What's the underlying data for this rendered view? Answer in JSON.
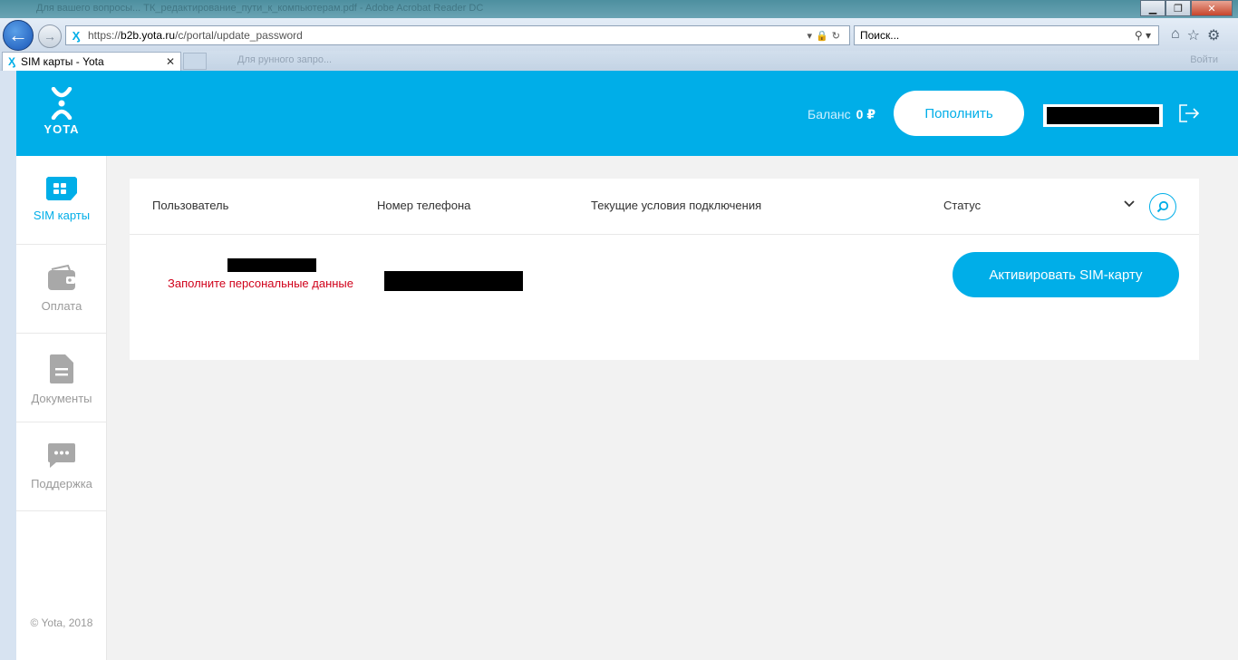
{
  "browser": {
    "title_text": "Для вашего вопросы... ТК_редактирование_пути_к_компьютерам.pdf - Adobe Acrobat Reader DC",
    "window_buttons": [
      "minimize",
      "restore",
      "close"
    ],
    "url_prefix": "https://",
    "url_domain": "b2b.yota.ru",
    "url_path": "/c/portal/update_password",
    "search_placeholder": "Поиск...",
    "tab_label": "SIM карты - Yota",
    "tab_favicon": "Ӽ",
    "blur_tab_label": "Для рунного запро...",
    "blur_right_label": "Войти"
  },
  "header": {
    "logo_text": "YOTA",
    "balance_label": "Баланс",
    "balance_value": "0 ₽",
    "topup_label": "Пополнить",
    "accent_color": "#00aee8"
  },
  "sidebar": {
    "items": [
      {
        "label": "SIM карты",
        "icon": "sim-card-icon",
        "active": true
      },
      {
        "label": "Оплата",
        "icon": "wallet-icon",
        "active": false
      },
      {
        "label": "Документы",
        "icon": "document-icon",
        "active": false
      },
      {
        "label": "Поддержка",
        "icon": "chat-icon",
        "active": false
      }
    ],
    "copyright": "© Yota, 2018"
  },
  "table": {
    "columns": [
      "Пользователь",
      "Номер телефона",
      "Текущие условия подключения",
      "Статус"
    ],
    "rows": [
      {
        "user_warning": "Заполните персональные данные"
      }
    ],
    "activate_label": "Активировать SIM-карту"
  }
}
